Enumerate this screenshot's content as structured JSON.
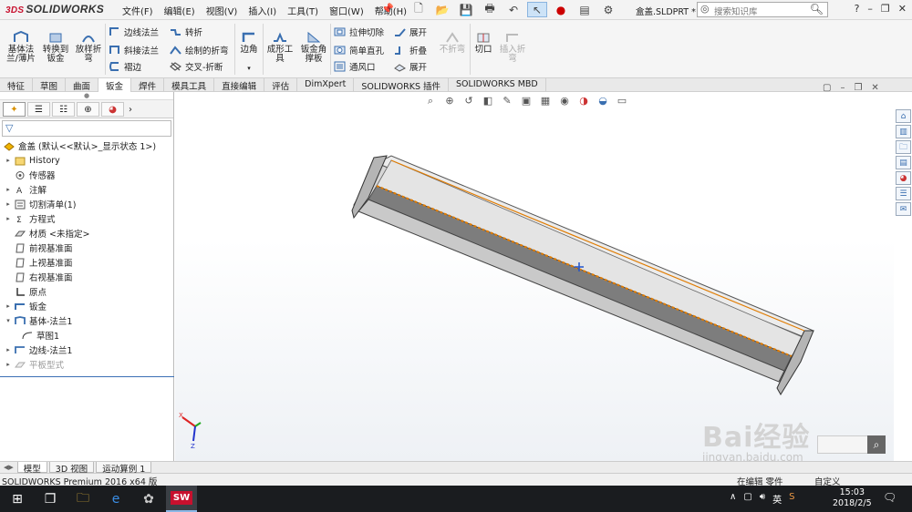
{
  "app": {
    "logo_prefix": "3DS",
    "logo_name": "SOLIDWORKS",
    "document": "盒盖.SLDPRT *",
    "search_placeholder": "搜索知识库"
  },
  "menu": [
    "文件(F)",
    "编辑(E)",
    "视图(V)",
    "插入(I)",
    "工具(T)",
    "窗口(W)",
    "帮助(H)"
  ],
  "ribbon": {
    "base_flange": "基体法\n兰/薄片",
    "convert": "转换到\n钣金",
    "lofted_bend": "放样折\n弯",
    "edge_flange": "边线法兰",
    "miter_flange": "斜接法兰",
    "hem": "褶边",
    "jog": "转折",
    "sketched_bend": "绘制的折弯",
    "cross_break": "交叉-折断",
    "corners": "边角",
    "forming_tool": "成形工\n具",
    "gusset": "钣金角\n撑板",
    "extruded_cut": "拉伸切除",
    "simple_hole": "简单直孔",
    "vent": "通风口",
    "unfold": "展开",
    "fold": "折叠",
    "flatten": "展开",
    "no_bends": "不折弯",
    "rip": "切口",
    "insert_bends": "插入折\n弯"
  },
  "tabs": [
    "特征",
    "草图",
    "曲面",
    "钣金",
    "焊件",
    "模具工具",
    "直接编辑",
    "评估",
    "DimXpert",
    "SOLIDWORKS 插件",
    "SOLIDWORKS MBD"
  ],
  "active_tab": "钣金",
  "tree": {
    "root": "盒盖 (默认<<默认>_显示状态 1>)",
    "items": [
      {
        "label": "History",
        "expandable": true
      },
      {
        "label": "传感器",
        "expandable": false
      },
      {
        "label": "注解",
        "expandable": true
      },
      {
        "label": "切割清单(1)",
        "expandable": true
      },
      {
        "label": "方程式",
        "expandable": true
      },
      {
        "label": "材质 <未指定>",
        "expandable": false
      },
      {
        "label": "前视基准面",
        "expandable": false
      },
      {
        "label": "上视基准面",
        "expandable": false
      },
      {
        "label": "右视基准面",
        "expandable": false
      },
      {
        "label": "原点",
        "expandable": false
      },
      {
        "label": "钣金",
        "expandable": true
      },
      {
        "label": "基体-法兰1",
        "expandable": true
      },
      {
        "label": "草图1",
        "expandable": false
      },
      {
        "label": "边线-法兰1",
        "expandable": true
      },
      {
        "label": "平板型式",
        "expandable": true
      }
    ]
  },
  "bottom_tabs": [
    "模型",
    "3D 视图",
    "运动算例 1"
  ],
  "status": {
    "left": "SOLIDWORKS Premium 2016 x64 版",
    "mid": "在编辑 零件",
    "right": "自定义"
  },
  "taskbar": {
    "time": "15:03",
    "date": "2018/2/5",
    "ime": "英"
  },
  "watermark": {
    "brand": "Bai经验",
    "url": "jingyan.baidu.com"
  },
  "colors": {
    "brand_red": "#c8102e",
    "selection_orange": "#e07b00",
    "accent_blue": "#3b6fb5"
  }
}
